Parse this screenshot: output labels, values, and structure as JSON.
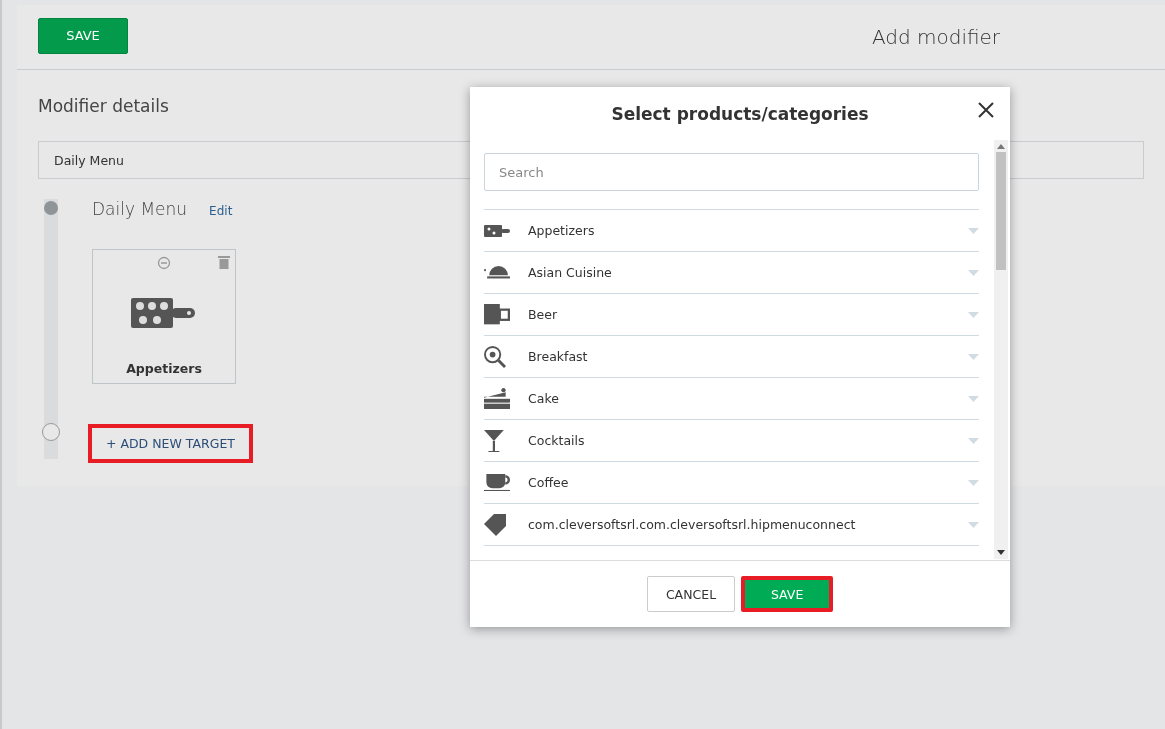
{
  "header": {
    "save_button": "SAVE",
    "title": "Add modifier"
  },
  "details": {
    "heading": "Modifier details",
    "name_field": {
      "value": "Daily Menu"
    },
    "timeline": {
      "title": "Daily Menu",
      "edit_link": "Edit",
      "targets": [
        {
          "label": "Appetizers"
        }
      ],
      "add_button": {
        "label": "+ ADD NEW TARGET",
        "highlighted": true
      }
    }
  },
  "dialog": {
    "title": "Select products/categories",
    "search": {
      "placeholder": "Search"
    },
    "items": [
      {
        "label": "Appetizers"
      },
      {
        "label": "Asian Cuisine"
      },
      {
        "label": "Beer"
      },
      {
        "label": "Breakfast"
      },
      {
        "label": "Cake"
      },
      {
        "label": "Cocktails"
      },
      {
        "label": "Coffee"
      },
      {
        "label": "com.cleversoftsrl.com.cleversoftsrl.hipmenuconnect"
      }
    ],
    "buttons": [
      {
        "label": "CANCEL",
        "kind": "secondary",
        "highlighted": false
      },
      {
        "label": "SAVE",
        "kind": "primary",
        "highlighted": true
      }
    ]
  }
}
